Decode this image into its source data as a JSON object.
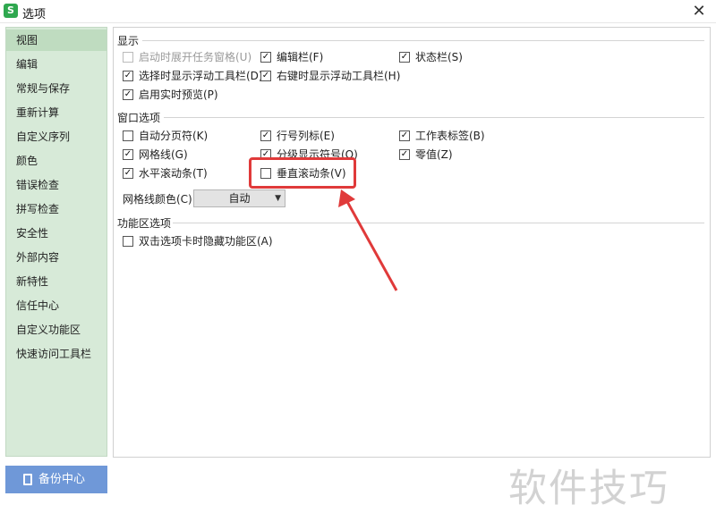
{
  "window": {
    "title": "选项",
    "app_icon_text": "S"
  },
  "sidebar": {
    "items": [
      {
        "label": "视图",
        "selected": true
      },
      {
        "label": "编辑"
      },
      {
        "label": "常规与保存"
      },
      {
        "label": "重新计算"
      },
      {
        "label": "自定义序列"
      },
      {
        "label": "颜色"
      },
      {
        "label": "错误检查"
      },
      {
        "label": "拼写检查"
      },
      {
        "label": "安全性"
      },
      {
        "label": "外部内容"
      },
      {
        "label": "新特性"
      },
      {
        "label": "信任中心"
      },
      {
        "label": "自定义功能区"
      },
      {
        "label": "快速访问工具栏"
      }
    ],
    "backup_label": "备份中心"
  },
  "sections": {
    "display": {
      "title": "显示",
      "options": [
        {
          "label": "启动时展开任务窗格(U)",
          "checked": false,
          "disabled": true
        },
        {
          "label": "编辑栏(F)",
          "checked": true
        },
        {
          "label": "状态栏(S)",
          "checked": true
        },
        {
          "label": "选择时显示浮动工具栏(D)",
          "checked": true
        },
        {
          "label": "右键时显示浮动工具栏(H)",
          "checked": true
        },
        {
          "label": "启用实时预览(P)",
          "checked": true
        }
      ]
    },
    "window_options": {
      "title": "窗口选项",
      "options": [
        {
          "label": "自动分页符(K)",
          "checked": false
        },
        {
          "label": "行号列标(E)",
          "checked": true
        },
        {
          "label": "工作表标签(B)",
          "checked": true
        },
        {
          "label": "网格线(G)",
          "checked": true
        },
        {
          "label": "分级显示符号(O)",
          "checked": true
        },
        {
          "label": "零值(Z)",
          "checked": true
        },
        {
          "label": "水平滚动条(T)",
          "checked": true
        },
        {
          "label": "垂直滚动条(V)",
          "checked": false
        }
      ],
      "gridline_color_label": "网格线颜色(C):",
      "gridline_color_value": "自动"
    },
    "ribbon_options": {
      "title": "功能区选项",
      "options": [
        {
          "label": "双击选项卡时隐藏功能区(A)",
          "checked": false
        }
      ]
    }
  },
  "watermark": "软件技巧",
  "colors": {
    "sidebar_bg": "#d7ead8",
    "backup_button": "#6f98d8",
    "annotation": "#e03a3a"
  }
}
